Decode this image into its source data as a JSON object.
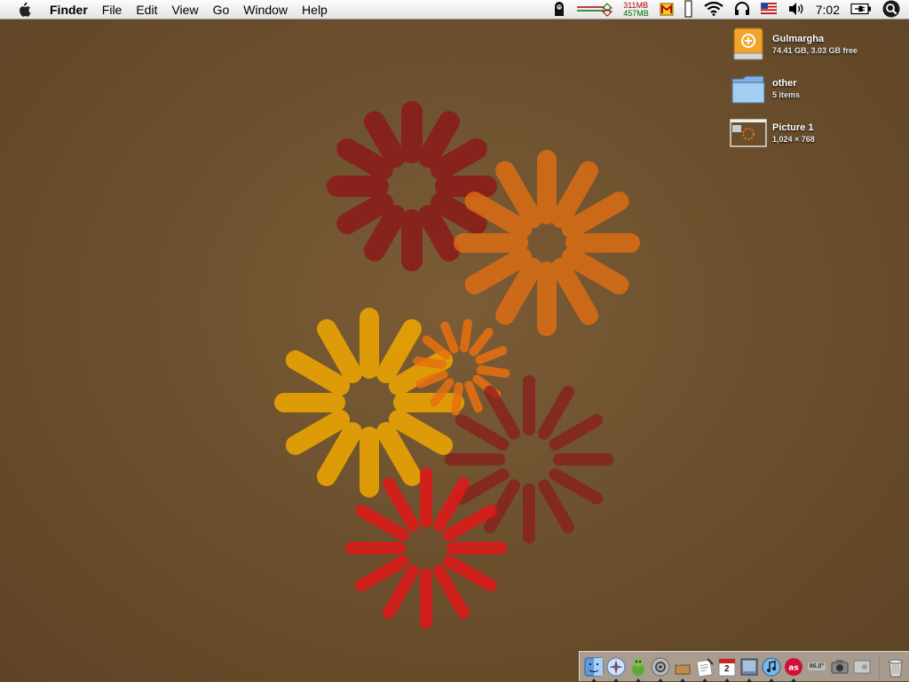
{
  "menubar": {
    "app_name": "Finder",
    "menus": [
      "File",
      "Edit",
      "View",
      "Go",
      "Window",
      "Help"
    ],
    "memory_used": "311MB",
    "memory_free": "457MB",
    "clock": "7:02"
  },
  "desktop_icons": [
    {
      "name": "Gulmargha",
      "detail": "74.41 GB, 3.03 GB free",
      "icon": "firewire-drive-icon"
    },
    {
      "name": "other",
      "detail": "5 items",
      "icon": "folder-icon"
    },
    {
      "name": "Picture 1",
      "detail": "1,024 × 768",
      "icon": "image-file-icon"
    }
  ],
  "dock": {
    "calendar_day": "2",
    "weather_temp": "86.0°"
  },
  "colors": {
    "desktop": "#6e5230",
    "spinner_dark_red": "#8b1a1a",
    "spinner_orange": "#e87010",
    "spinner_gold": "#f0a800",
    "spinner_red": "#e01818"
  }
}
